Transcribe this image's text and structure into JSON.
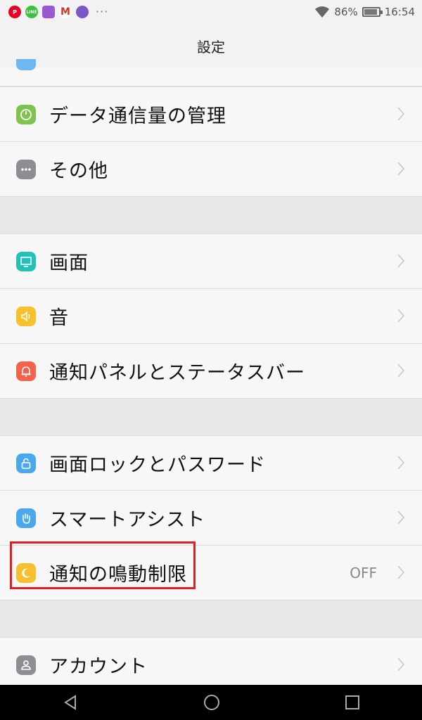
{
  "status_bar": {
    "apps": [
      {
        "icon": "pinterest-icon",
        "color": "#e60023",
        "text": "P"
      },
      {
        "icon": "line-icon",
        "color": "#3ec13e",
        "text": "LINE"
      },
      {
        "icon": "gallery-icon",
        "color": "#9b59d0",
        "text": ""
      },
      {
        "icon": "gmail-icon",
        "color": "#d93025",
        "text": "M"
      },
      {
        "icon": "app-icon",
        "color": "#7b57c8",
        "text": ""
      }
    ],
    "more": "···",
    "battery": "86%",
    "time": "16:54"
  },
  "header": {
    "title": "設定"
  },
  "groups": [
    [
      {
        "label": "データ通信量の管理",
        "icon": "data-usage-icon",
        "color": "#7ec34e"
      },
      {
        "label": "その他",
        "icon": "more-icon",
        "color": "#8d8d93"
      }
    ],
    [
      {
        "label": "画面",
        "icon": "display-icon",
        "color": "#22c2b8"
      },
      {
        "label": "音",
        "icon": "sound-icon",
        "color": "#f6c12c"
      },
      {
        "label": "通知パネルとステータスバー",
        "icon": "notification-bell-icon",
        "color": "#f4624a"
      }
    ],
    [
      {
        "label": "画面ロックとパスワード",
        "icon": "lock-icon",
        "color": "#4aa8ef"
      },
      {
        "label": "スマートアシスト",
        "icon": "hand-icon",
        "color": "#4aa8ef"
      },
      {
        "label": "通知の鳴動制限",
        "icon": "moon-icon",
        "color": "#f6c12c",
        "value": "OFF"
      }
    ],
    [
      {
        "label": "アカウント",
        "icon": "account-icon",
        "color": "#8d8d93"
      }
    ]
  ],
  "highlight_color": "#e02020"
}
